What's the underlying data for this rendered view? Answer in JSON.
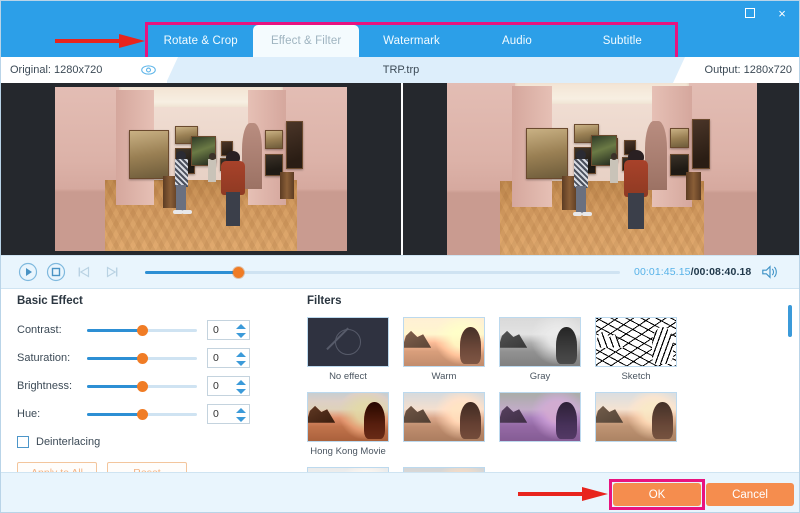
{
  "window": {
    "maximize_icon": "maximize-icon",
    "close_icon": "close-icon",
    "close_glyph": "×"
  },
  "tabs": [
    {
      "id": "rotate-crop",
      "label": "Rotate & Crop",
      "active": false
    },
    {
      "id": "effect-filter",
      "label": "Effect & Filter",
      "active": true
    },
    {
      "id": "watermark",
      "label": "Watermark",
      "active": false
    },
    {
      "id": "audio",
      "label": "Audio",
      "active": false
    },
    {
      "id": "subtitle",
      "label": "Subtitle",
      "active": false
    }
  ],
  "info": {
    "original_label": "Original: 1280x720",
    "file_name": "TRP.trp",
    "output_label": "Output: 1280x720",
    "eye_icon": "eye-icon"
  },
  "transport": {
    "play_icon": "play-icon",
    "stop_icon": "stop-icon",
    "prev_frame_icon": "previous-frame-icon",
    "next_frame_icon": "next-frame-icon",
    "volume_icon": "volume-icon",
    "current_time": "00:01:45.15",
    "separator": "/",
    "total_time": "00:08:40.18",
    "progress_percent": 19.5
  },
  "basic_effect": {
    "title": "Basic Effect",
    "sliders": [
      {
        "label": "Contrast:",
        "value": "0",
        "percent": 50
      },
      {
        "label": "Saturation:",
        "value": "0",
        "percent": 50
      },
      {
        "label": "Brightness:",
        "value": "0",
        "percent": 50
      },
      {
        "label": "Hue:",
        "value": "0",
        "percent": 50
      }
    ],
    "deinterlacing_label": "Deinterlacing",
    "deinterlacing_checked": false,
    "apply_to_all_label": "Apply to All",
    "reset_label": "Reset"
  },
  "filters": {
    "title": "Filters",
    "items": [
      {
        "id": "no-effect",
        "label": "No effect",
        "style": "noeffect"
      },
      {
        "id": "warm",
        "label": "Warm",
        "style": "ds-warm"
      },
      {
        "id": "gray",
        "label": "Gray",
        "style": "ds-gray"
      },
      {
        "id": "sketch",
        "label": "Sketch",
        "style": "ds-sketch"
      },
      {
        "id": "hong-kong-movie",
        "label": "Hong Kong Movie",
        "style": "ds-hk"
      },
      {
        "id": "filter-6",
        "label": "",
        "style": "ds-r2a"
      },
      {
        "id": "filter-7",
        "label": "",
        "style": "ds-r2b"
      },
      {
        "id": "filter-8",
        "label": "",
        "style": "ds-r2c"
      },
      {
        "id": "filter-9",
        "label": "",
        "style": "ds-r2d"
      },
      {
        "id": "filter-10",
        "label": "",
        "style": "ds-r2e"
      }
    ]
  },
  "footer": {
    "ok_label": "OK",
    "cancel_label": "Cancel"
  },
  "annotations": {
    "arrow_color": "#e8241d",
    "highlight_color": "#e8137f"
  },
  "colors": {
    "title_bar": "#2c9fe8",
    "accent_orange": "#f58d4e",
    "slider_blue": "#2d8fd4",
    "panel_bg": "#e9f5fd"
  }
}
